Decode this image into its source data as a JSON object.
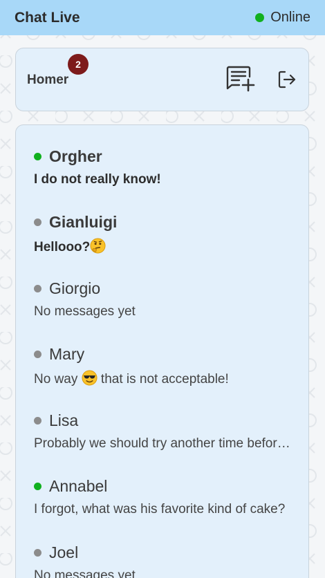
{
  "header": {
    "app_title": "Chat Live",
    "status_label": "Online",
    "status_color": "#11b01f"
  },
  "user": {
    "name": "Homer",
    "unread_count": "2"
  },
  "icons": {
    "new_chat": "new-chat-icon",
    "logout": "logout-icon"
  },
  "chats": [
    {
      "name": "Orgher",
      "preview": "I do not really know!",
      "online": true,
      "unread": true
    },
    {
      "name": "Gianluigi",
      "preview": "Hellooo?",
      "emoji": "thinking-face",
      "online": false,
      "unread": true
    },
    {
      "name": "Giorgio",
      "preview": "No messages yet",
      "online": false,
      "unread": false
    },
    {
      "name": "Mary",
      "preview_before": "No way",
      "emoji": "sunglasses-face",
      "preview_after": "that is not acceptable!",
      "online": false,
      "unread": false
    },
    {
      "name": "Lisa",
      "preview": "Probably we should try another time before to go",
      "online": false,
      "unread": false
    },
    {
      "name": "Annabel",
      "preview": "I forgot, what was his favorite kind of cake?",
      "online": true,
      "unread": false
    },
    {
      "name": "Joel",
      "preview": "No messages yet",
      "online": false,
      "unread": false
    }
  ],
  "colors": {
    "online": "#11b01f",
    "offline": "#8c8c8c",
    "badge": "#7d1b1b",
    "header_bg": "#a8d8f8",
    "card_bg": "#e3f0fb"
  }
}
